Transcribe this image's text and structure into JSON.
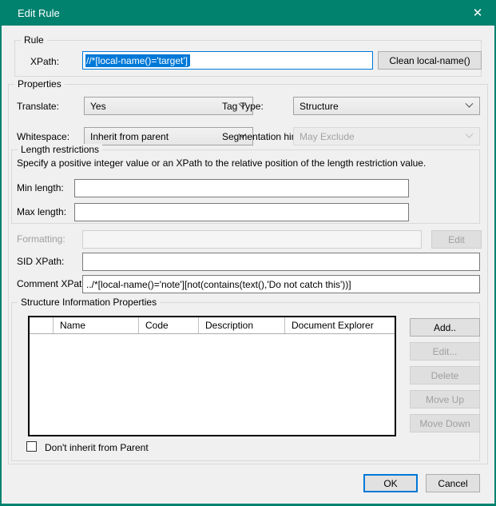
{
  "window": {
    "title": "Edit Rule",
    "close_glyph": "✕"
  },
  "colors": {
    "titlebar": "#00826F",
    "selection": "#0078D7",
    "focus_border": "#0078D7",
    "dialog_bg": "#F0F0F0"
  },
  "rule_group": {
    "label": "Rule",
    "xpath_label": "XPath:",
    "xpath_value": "//*[local-name()='target']",
    "xpath_selected": true,
    "clean_button": "Clean local-name()"
  },
  "properties_group": {
    "label": "Properties",
    "translate": {
      "label": "Translate:",
      "value": "Yes",
      "enabled": true
    },
    "tag_type": {
      "label": "Tag Type:",
      "value": "Structure",
      "enabled": true
    },
    "whitespace": {
      "label": "Whitespace:",
      "value": "Inherit from parent",
      "enabled": true
    },
    "segmentation_hint": {
      "label": "Segmentation hint:",
      "value": "May Exclude",
      "enabled": false
    }
  },
  "length_group": {
    "label": "Length restrictions",
    "description": "Specify a positive integer value or an XPath to the relative position of the length restriction value.",
    "min": {
      "label": "Min length:",
      "value": ""
    },
    "max": {
      "label": "Max length:",
      "value": ""
    }
  },
  "formatting": {
    "label": "Formatting:",
    "value": "",
    "edit_button": "Edit",
    "enabled": false
  },
  "sid": {
    "label": "SID XPath:",
    "value": ""
  },
  "comment": {
    "label": "Comment XPath:",
    "value": "../*[local-name()='note'][not(contains(text(),'Do not catch this'))]"
  },
  "structure_group": {
    "label": "Structure Information Properties",
    "columns": [
      "",
      "Name",
      "Code",
      "Description",
      "Document Explorer"
    ],
    "rows": [],
    "buttons": {
      "add": "Add..",
      "edit": "Edit...",
      "delete": "Delete",
      "move_up": "Move Up",
      "move_down": "Move Down"
    },
    "checkbox_label": "Don't inherit from Parent",
    "checkbox_checked": false
  },
  "footer": {
    "ok": "OK",
    "cancel": "Cancel"
  }
}
